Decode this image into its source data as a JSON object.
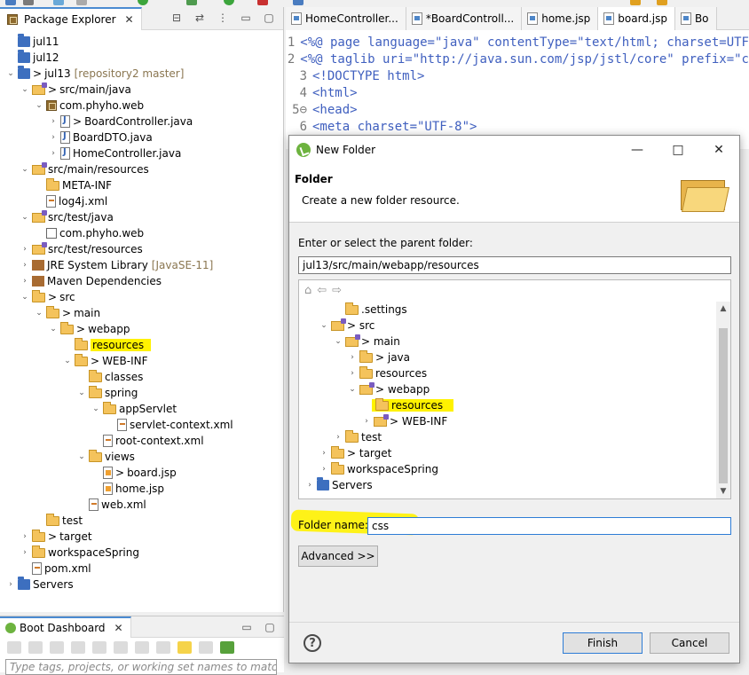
{
  "package_explorer": {
    "tab_label": "Package Explorer",
    "items": [
      {
        "label": "jul11",
        "icon": "project-icon"
      },
      {
        "label": "jul12",
        "icon": "project-icon"
      },
      {
        "label": "jul13",
        "prefix": ">",
        "suffix": "[repository2 master]",
        "icon": "maven-project-icon"
      },
      {
        "label": "src/main/java",
        "prefix": ">",
        "icon": "source-folder-icon"
      },
      {
        "label": "com.phyho.web",
        "icon": "package-icon"
      },
      {
        "label": "BoardController.java",
        "prefix": ">",
        "icon": "java-file-icon"
      },
      {
        "label": "BoardDTO.java",
        "icon": "java-file-icon"
      },
      {
        "label": "HomeController.java",
        "icon": "java-file-icon"
      },
      {
        "label": "src/main/resources",
        "icon": "source-folder-icon"
      },
      {
        "label": "META-INF",
        "icon": "folder-icon"
      },
      {
        "label": "log4j.xml",
        "icon": "xml-file-icon"
      },
      {
        "label": "src/test/java",
        "icon": "source-folder-icon"
      },
      {
        "label": "com.phyho.web",
        "icon": "empty-package-icon"
      },
      {
        "label": "src/test/resources",
        "icon": "source-folder-icon"
      },
      {
        "label": "JRE System Library",
        "suffix": "[JavaSE-11]",
        "icon": "library-icon"
      },
      {
        "label": "Maven Dependencies",
        "icon": "library-icon"
      },
      {
        "label": "src",
        "prefix": ">",
        "icon": "folder-icon"
      },
      {
        "label": "main",
        "prefix": ">",
        "icon": "folder-icon"
      },
      {
        "label": "webapp",
        "prefix": ">",
        "icon": "folder-icon"
      },
      {
        "label": "resources",
        "icon": "folder-icon"
      },
      {
        "label": "WEB-INF",
        "prefix": ">",
        "icon": "folder-icon"
      },
      {
        "label": "classes",
        "icon": "folder-icon"
      },
      {
        "label": "spring",
        "icon": "folder-icon"
      },
      {
        "label": "appServlet",
        "icon": "folder-icon"
      },
      {
        "label": "servlet-context.xml",
        "icon": "xml-file-icon"
      },
      {
        "label": "root-context.xml",
        "icon": "xml-file-icon"
      },
      {
        "label": "views",
        "icon": "folder-icon"
      },
      {
        "label": "board.jsp",
        "prefix": ">",
        "icon": "jsp-file-icon"
      },
      {
        "label": "home.jsp",
        "icon": "jsp-file-icon"
      },
      {
        "label": "web.xml",
        "icon": "xml-file-icon"
      },
      {
        "label": "test",
        "icon": "folder-icon"
      },
      {
        "label": "target",
        "prefix": ">",
        "icon": "folder-icon"
      },
      {
        "label": "workspaceSpring",
        "icon": "folder-icon"
      },
      {
        "label": "pom.xml",
        "icon": "xml-file-icon"
      },
      {
        "label": "Servers",
        "icon": "project-icon"
      }
    ]
  },
  "boot_dashboard": {
    "tab_label": "Boot Dashboard",
    "filter_placeholder": "Type tags, projects, or working set names to match (inc"
  },
  "editor": {
    "tabs": [
      "HomeController...",
      "*BoardControll...",
      "home.jsp",
      "board.jsp",
      "Bo"
    ],
    "lines": [
      {
        "n": "1",
        "text": "<%@ page language=\"java\" contentType=\"text/html; charset=UTF"
      },
      {
        "n": "2",
        "text": "<%@ taglib uri=\"http://java.sun.com/jsp/jstl/core\" prefix=\"c"
      },
      {
        "n": "3",
        "text": "<!DOCTYPE html>"
      },
      {
        "n": "4",
        "text": "<html>"
      },
      {
        "n": "5⊖",
        "text": "<head>"
      },
      {
        "n": "6",
        "text": "<meta charset=\"UTF-8\">"
      }
    ]
  },
  "dialog": {
    "title": "New Folder",
    "banner_title": "Folder",
    "banner_desc": "Create a new folder resource.",
    "parent_label": "Enter or select the parent folder:",
    "parent_value": "jul13/src/main/webapp/resources",
    "tree": [
      {
        "label": ".settings"
      },
      {
        "label": "> src"
      },
      {
        "label": "> main"
      },
      {
        "label": "> java"
      },
      {
        "label": "resources"
      },
      {
        "label": "> webapp"
      },
      {
        "label": "resources"
      },
      {
        "label": "> WEB-INF"
      },
      {
        "label": "test"
      },
      {
        "label": "> target"
      },
      {
        "label": "workspaceSpring"
      },
      {
        "label": "Servers"
      }
    ],
    "folder_name_label": "Folder name:",
    "folder_name_value": "css",
    "advanced_label": "Advanced >>",
    "finish_label": "Finish",
    "cancel_label": "Cancel",
    "help_glyph": "?",
    "window_buttons": [
      "—",
      "□",
      "✕"
    ]
  },
  "colors": {
    "highlight": "#fff200",
    "selection": "#d8e6f8",
    "accent": "#2d7cd6"
  }
}
